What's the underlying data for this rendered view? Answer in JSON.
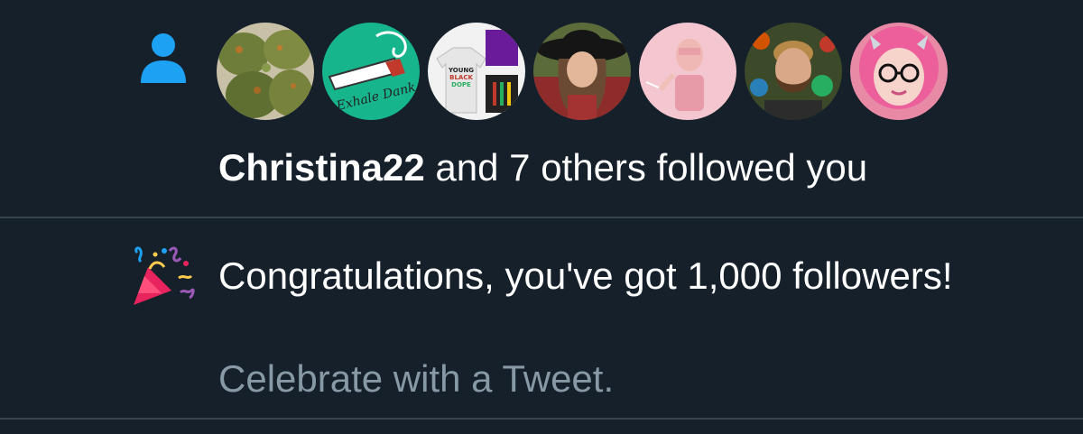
{
  "colors": {
    "background": "#15202b",
    "divider": "#38444d",
    "primary_text": "#ffffff",
    "secondary_text": "#8899a6",
    "accent_blue": "#1da1f2"
  },
  "follow_notification": {
    "icon": "person-icon",
    "avatars": [
      {
        "name": "avatar-1",
        "depicts": "cannabis buds"
      },
      {
        "name": "avatar-2",
        "depicts": "Exhale Dank logo"
      },
      {
        "name": "avatar-3",
        "depicts": "Young Black Dope apparel"
      },
      {
        "name": "avatar-4",
        "depicts": "woman in black hat"
      },
      {
        "name": "avatar-5",
        "depicts": "woman in pink"
      },
      {
        "name": "avatar-6",
        "depicts": "bearded man"
      },
      {
        "name": "avatar-7",
        "depicts": "woman with pink hair and glasses"
      }
    ],
    "actor": "Christina22",
    "rest": " and 7 others followed you"
  },
  "avatar_labels": {
    "exhale_dank": "Exhale Dank",
    "young_black_dope": [
      "YOUNG",
      "BLACK",
      "DOPE"
    ]
  },
  "milestone_notification": {
    "icon": "party-popper-icon",
    "message": "Congratulations, you've got 1,000 followers!",
    "cta": "Celebrate with a Tweet."
  }
}
